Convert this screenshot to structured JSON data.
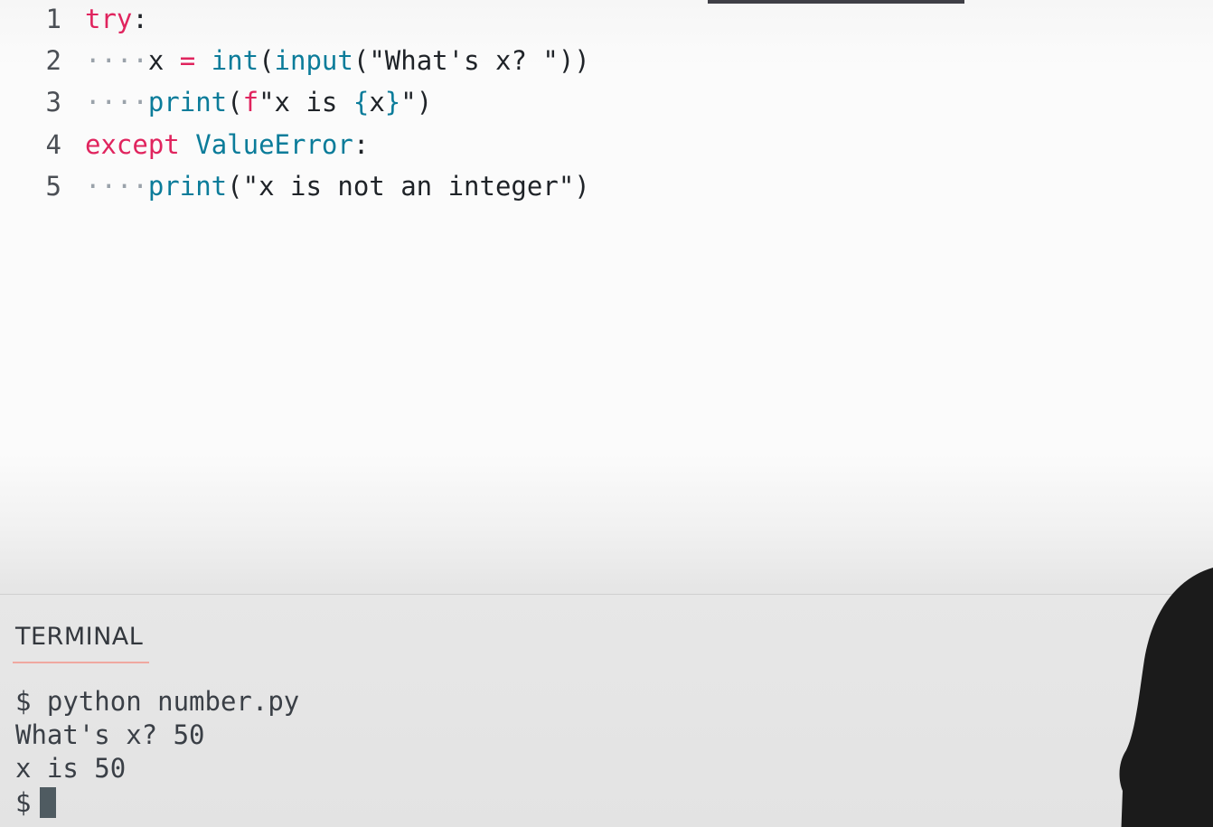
{
  "editor": {
    "lines": [
      {
        "number": "1",
        "dots": "",
        "t1": "try",
        "t2": ":",
        "t3": "",
        "t4": "",
        "t5": "",
        "t6": "",
        "t7": "",
        "t8": "",
        "t9": ""
      },
      {
        "number": "2",
        "dots": "····",
        "t1": "x ",
        "t2": "=",
        "t3": " int",
        "t4": "(",
        "t5": "input",
        "t6": "(",
        "t7": "\"What's x? \"",
        "t8": "))",
        "t9": ""
      },
      {
        "number": "3",
        "dots": "····",
        "t1": "print",
        "t2": "(",
        "t3": "f",
        "t4": "\"x is ",
        "t5": "{",
        "t6": "x",
        "t7": "}",
        "t8": "\")",
        "t9": ""
      },
      {
        "number": "4",
        "dots": "",
        "t1": "except",
        "t2": " ",
        "t3": "ValueError",
        "t4": ":",
        "t5": "",
        "t6": "",
        "t7": "",
        "t8": "",
        "t9": ""
      },
      {
        "number": "5",
        "dots": "····",
        "t1": "print",
        "t2": "(",
        "t3": "\"x is not an integer\"",
        "t4": ")",
        "t5": "",
        "t6": "",
        "t7": "",
        "t8": "",
        "t9": ""
      }
    ]
  },
  "terminal": {
    "tab_label": "TERMINAL",
    "lines": [
      "$ python number.py",
      "What's x? 50",
      "x is 50",
      "$"
    ]
  },
  "colors": {
    "keyword": "#e0245e",
    "function": "#0b7c9a",
    "text": "#1f2328",
    "terminal_underline": "#f0a8a0"
  }
}
